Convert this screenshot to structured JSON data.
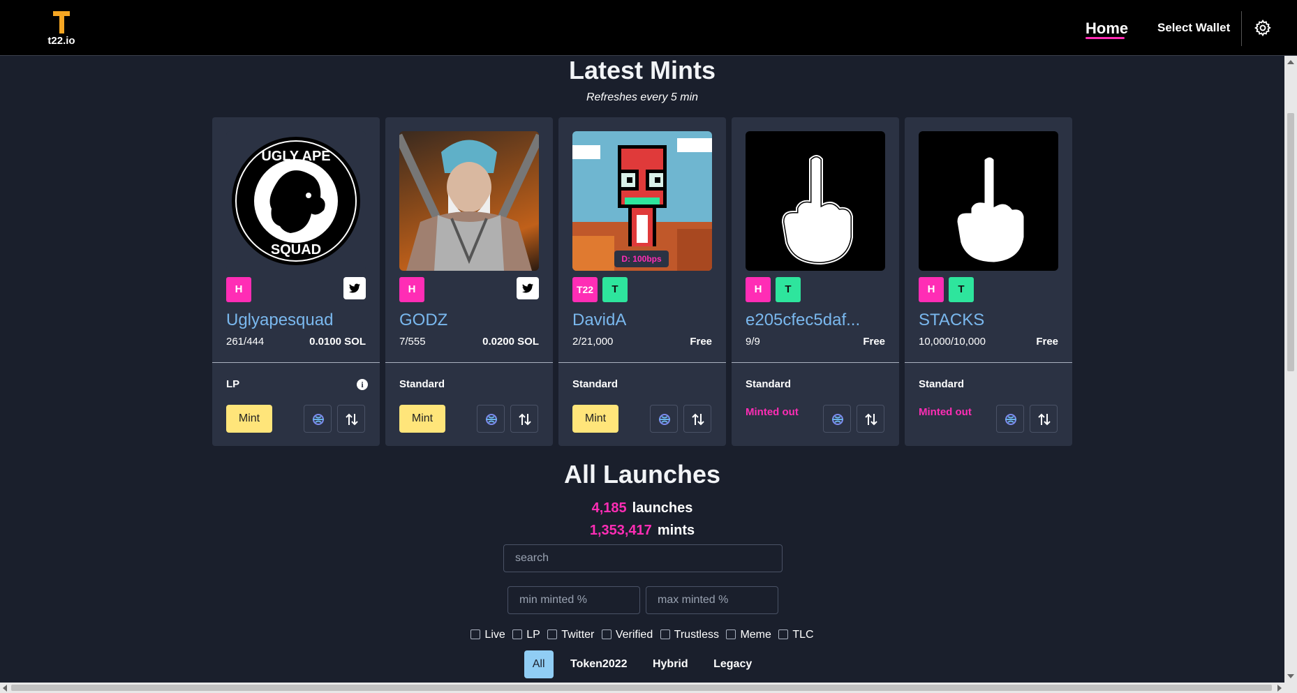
{
  "header": {
    "logo_text": "t22.io",
    "nav_home": "Home",
    "nav_wallet": "Select Wallet",
    "settings_icon": "gear-icon"
  },
  "latest": {
    "title": "Latest Mints",
    "subtitle": "Refreshes every 5 min",
    "mint_label": "Mint",
    "minted_out_label": "Minted out",
    "cards": [
      {
        "name": "Uglyapesquad",
        "count": "261/444",
        "price": "0.0100 SOL",
        "type": "LP",
        "badges": [
          "H"
        ],
        "twitter": true,
        "minted_out": false
      },
      {
        "name": "GODZ",
        "count": "7/555",
        "price": "0.0200 SOL",
        "type": "Standard",
        "badges": [
          "H"
        ],
        "twitter": true,
        "minted_out": false
      },
      {
        "name": "DavidA",
        "count": "2/21,000",
        "price": "Free",
        "type": "Standard",
        "badges": [
          "T22",
          "T"
        ],
        "twitter": false,
        "minted_out": false,
        "image_tag": "D: 100bps"
      },
      {
        "name": "e205cfec5daf...",
        "count": "9/9",
        "price": "Free",
        "type": "Standard",
        "badges": [
          "H",
          "T"
        ],
        "twitter": false,
        "minted_out": true
      },
      {
        "name": "STACKS",
        "count": "10,000/10,000",
        "price": "Free",
        "type": "Standard",
        "badges": [
          "H",
          "T"
        ],
        "twitter": false,
        "minted_out": true
      }
    ],
    "ugly_ape_text_top": "UGLY APE",
    "ugly_ape_text_bottom": "SQUAD"
  },
  "launches": {
    "title": "All Launches",
    "launch_count": "4,185",
    "launch_label": "launches",
    "mint_count": "1,353,417",
    "mint_label": "mints",
    "search_placeholder": "search",
    "min_placeholder": "min minted %",
    "max_placeholder": "max minted %",
    "filters": [
      "Live",
      "LP",
      "Twitter",
      "Verified",
      "Trustless",
      "Meme",
      "TLC"
    ],
    "tabs": [
      "All",
      "Token2022",
      "Hybrid",
      "Legacy"
    ],
    "active_tab": "All"
  },
  "colors": {
    "accent_pink": "#ff2db5",
    "accent_green": "#2ee59d",
    "mint_yellow": "#ffe57a",
    "link_blue": "#7ab8ee",
    "logo_orange": "#f5a623"
  }
}
